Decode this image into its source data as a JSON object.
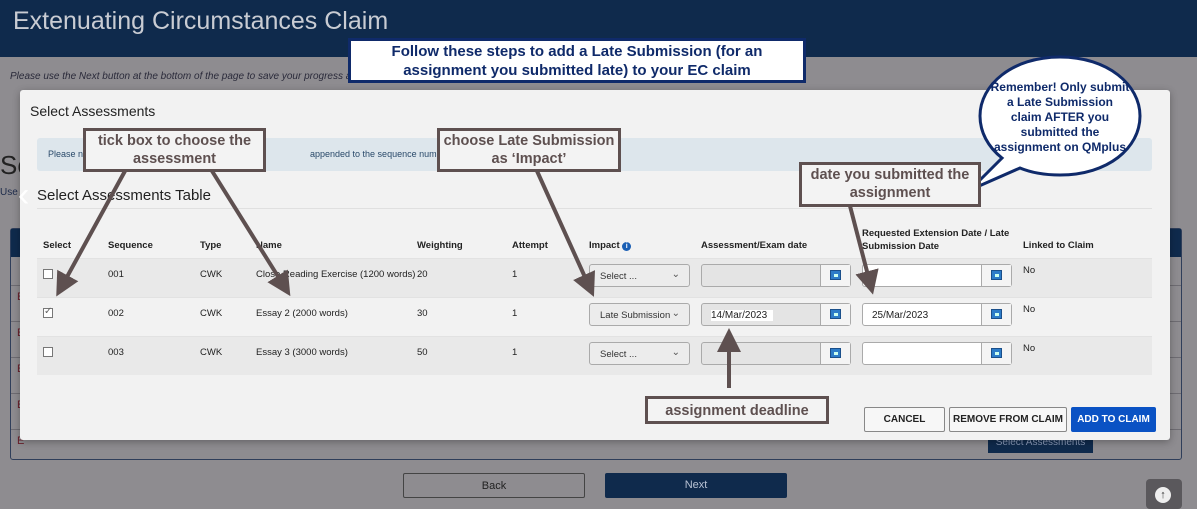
{
  "header": {
    "title": "Extenuating Circumstances Claim"
  },
  "page": {
    "hint": "Please use the Next button at the bottom of the page to save your progress an",
    "section_heading_partial": "Se",
    "instruction_partial": "Use",
    "background_row_initials": [
      "E",
      "E",
      "E",
      "E",
      "E"
    ],
    "background_select_button": "Select Assessments",
    "back_label": "Back",
    "next_label": "Next",
    "scroll_top_icon": "arrow-up-circle-icon"
  },
  "modal": {
    "title": "Select Assessments",
    "alert_start": "Please n",
    "alert_end": "appended to the sequence number",
    "table_title": "Select Assessments Table",
    "columns": [
      "Select",
      "Sequence",
      "Type",
      "Name",
      "Weighting",
      "Attempt",
      "Impact",
      "Assessment/Exam date",
      "Requested Extension Date / Late Submission Date",
      "Linked to Claim"
    ],
    "rows": [
      {
        "selected": false,
        "sequence": "001",
        "type": "CWK",
        "name": "Close Reading Exercise (1200 words)",
        "weighting": "20",
        "attempt": "1",
        "impact": "Select ...",
        "assessment_date": "",
        "requested_date": "",
        "linked": "No"
      },
      {
        "selected": true,
        "sequence": "002",
        "type": "CWK",
        "name": "Essay 2 (2000 words)",
        "weighting": "30",
        "attempt": "1",
        "impact": "Late Submission",
        "assessment_date": "14/Mar/2023",
        "requested_date": "25/Mar/2023",
        "linked": "No"
      },
      {
        "selected": false,
        "sequence": "003",
        "type": "CWK",
        "name": "Essay 3 (3000 words)",
        "weighting": "50",
        "attempt": "1",
        "impact": "Select ...",
        "assessment_date": "",
        "requested_date": "",
        "linked": "No"
      }
    ],
    "buttons": {
      "cancel": "CANCEL",
      "remove": "REMOVE FROM CLAIM",
      "add": "ADD TO CLAIM"
    },
    "accent": "#0a52c4"
  },
  "annotations": {
    "steps": "Follow these steps to add a Late Submission (for an assignment you submitted late) to your EC claim",
    "tick": "tick box to choose the assessment",
    "impact": "choose Late Submission as ‘Impact’",
    "date": "date you submitted the assignment",
    "deadline": "assignment deadline",
    "remember": "Remember! Only submit a Late Submission claim AFTER you submitted the assignment on QMplus"
  }
}
